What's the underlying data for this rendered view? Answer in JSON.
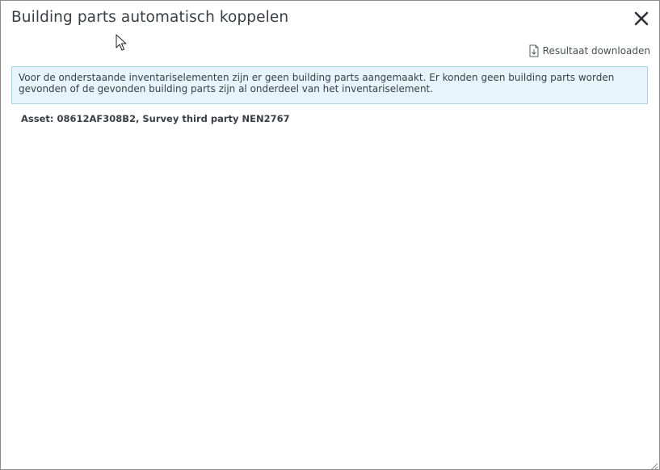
{
  "dialog": {
    "title": "Building parts automatisch koppelen",
    "download_label": "Resultaat downloaden",
    "info_message": "Voor de onderstaande inventariselementen zijn er geen building parts aangemaakt. Er konden geen building parts worden gevonden of de gevonden building parts zijn al onderdeel van het inventariselement.",
    "asset_line": "Asset: 08612AF308B2, Survey third party NEN2767"
  },
  "icons": {
    "close": "close-icon",
    "download": "download-file-icon",
    "resize": "resize-grip-icon",
    "cursor": "mouse-pointer-icon"
  },
  "colors": {
    "info_background": "#e6f4fb",
    "info_border": "#a9d2e6",
    "text": "#3a3f45"
  }
}
